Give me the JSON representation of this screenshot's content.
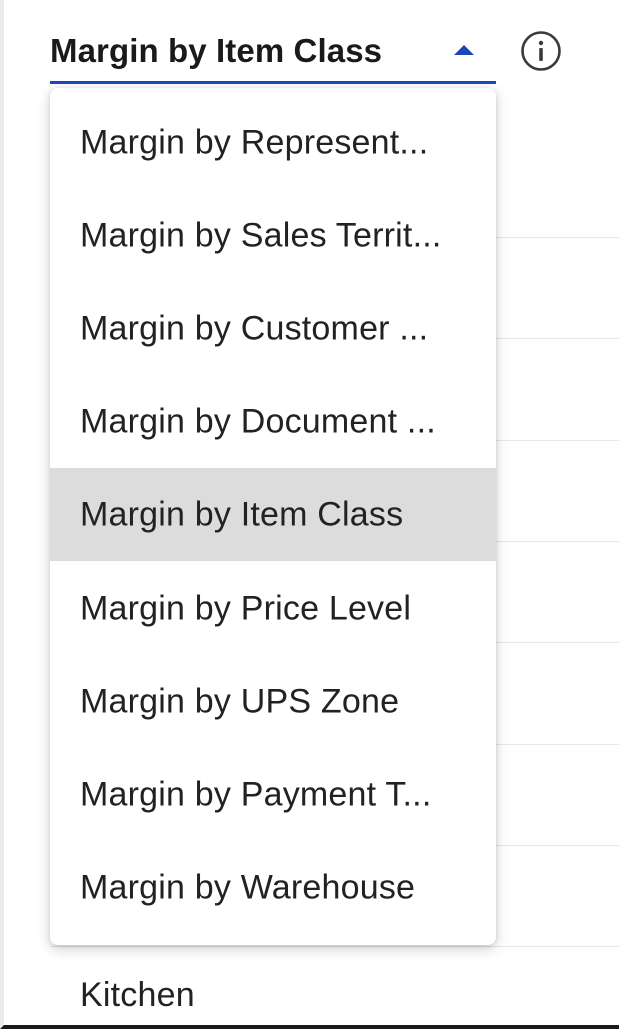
{
  "select": {
    "value": "Margin by Item Class",
    "accent_color": "#1c47b8"
  },
  "info_icon": "info-icon",
  "menu": {
    "items": [
      {
        "label": "Margin by Represent..."
      },
      {
        "label": "Margin by Sales Territ..."
      },
      {
        "label": "Margin by Customer ..."
      },
      {
        "label": "Margin by Document ..."
      },
      {
        "label": "Margin by Item Class",
        "selected": true
      },
      {
        "label": "Margin by Price Level"
      },
      {
        "label": "Margin by UPS Zone"
      },
      {
        "label": "Margin by Payment T..."
      },
      {
        "label": "Margin by Warehouse"
      }
    ],
    "selected_bg": "#dcdcdc"
  },
  "background_list": {
    "visible_item": "Kitchen"
  }
}
